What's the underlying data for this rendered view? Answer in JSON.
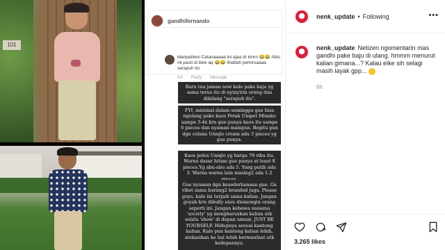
{
  "post": {
    "username": "nenk_update",
    "follow_status": "Following",
    "caption": "Netizen ngomentarin mas gandhi pake baju di ulang. hmmm menurut kalian gimana...? Kalau eike sih selagi masih layak gpp...",
    "age": "6h",
    "likes": "3.265 likes"
  },
  "story": {
    "header_user": "gandhifernando",
    "comment": {
      "text": "blanpahlevi Celanaaaaa ini ajaa dr kmrn 😂😂 Abis ini pasti di blok aq 😂😂 lihatlah pemirsaaaa serapuh itu",
      "meta": [
        "5m",
        "Reply",
        "Message"
      ]
    },
    "replies": [
      "Baru tau jaman now kalo pake baju yg sama terus itu di nyinyirin orang dan dibilang \"serapuh itu\".",
      "FYI, minimal dalam seminggu gue bisa ngulang pake kaos Petak Umpet Minako sampe 3-4x krn gue punya kaos itu sampe 6 pieces dan nyaman mampus. Begitu pun dgn celana Uniqlo cream ada 3 pieces yg gue punya.",
      "Kaos polos Uniqlo yg harga 79 ribu itu. Warna dasar hitam gue punya at least 8 pieces.Yg abu-abu ada 5. Yang putih ada 3. Warna-warna lain masing2 ada 1-2 pieces.",
      "Gue nyaman dgn kesederhanaan gue. Ga ribet sama barang2 branded juga. Please guys, kalo ini terjadi sama kalian. Jangan goyah krn dibully atau diomongin orang seperti ini. Jangan kebawa suasana 'society' yg mengharuskan kalian utk selalu 'show' di depan umum. JUST BE YOURSELF. Hidupnya sesuai kantong kalian. Kalo pun kantong kalian lebih, alokasikan ke hal lebih bermanfaat utk kedepannya."
    ]
  },
  "photos": {
    "door_sign": "101"
  },
  "icons": {
    "more": "more-options-icon",
    "like": "heart-icon",
    "comment": "comment-icon",
    "share": "share-icon",
    "save": "bookmark-icon"
  }
}
